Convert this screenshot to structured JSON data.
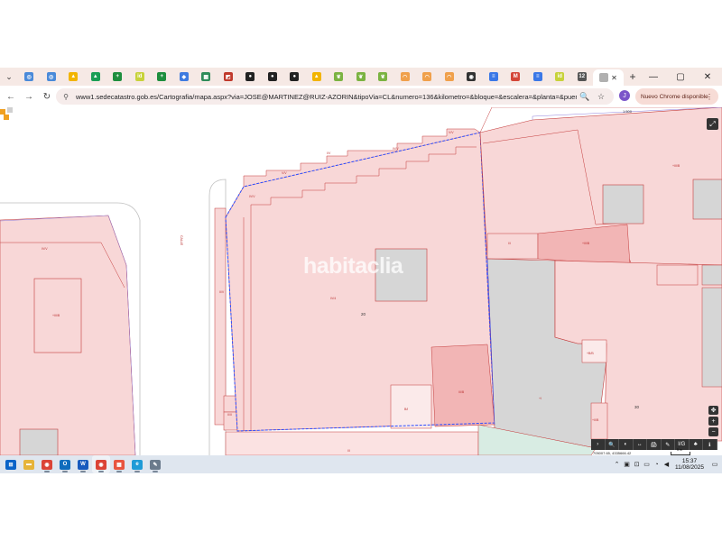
{
  "browser": {
    "tabs": [
      {
        "icon": "tab-favicon-1",
        "color": "#4a8ad9",
        "glyph": "◎"
      },
      {
        "icon": "tab-favicon-2",
        "color": "#4a8ad9",
        "glyph": "◎"
      },
      {
        "icon": "google-drive-icon",
        "color": "#f2b400",
        "glyph": "▲"
      },
      {
        "icon": "google-drive-icon",
        "color": "#1a9e55",
        "glyph": "▲"
      },
      {
        "icon": "google-sheets-icon",
        "color": "#1e8e3e",
        "glyph": "+"
      },
      {
        "icon": "idealista-icon",
        "color": "#c7d23a",
        "glyph": "id"
      },
      {
        "icon": "google-sheets-icon",
        "color": "#1e8e3e",
        "glyph": "+"
      },
      {
        "icon": "maps-icon",
        "color": "#3f7be0",
        "glyph": "◆"
      },
      {
        "icon": "sheets-grid-icon",
        "color": "#2f8c5a",
        "glyph": "▦"
      },
      {
        "icon": "red-doc-icon",
        "color": "#c0392b",
        "glyph": "◩"
      },
      {
        "icon": "black-circle-icon",
        "color": "#222222",
        "glyph": "●"
      },
      {
        "icon": "black-circle-icon",
        "color": "#222222",
        "glyph": "●"
      },
      {
        "icon": "black-circle-icon",
        "color": "#222222",
        "glyph": "●"
      },
      {
        "icon": "google-drive-icon",
        "color": "#f2b400",
        "glyph": "▲"
      },
      {
        "icon": "green-leaf-icon",
        "color": "#7bb342",
        "glyph": "❦"
      },
      {
        "icon": "green-leaf-icon",
        "color": "#7bb342",
        "glyph": "❦"
      },
      {
        "icon": "green-leaf-icon",
        "color": "#7bb342",
        "glyph": "❦"
      },
      {
        "icon": "orange-arc-icon",
        "color": "#f0a04b",
        "glyph": "◠"
      },
      {
        "icon": "orange-arc-icon",
        "color": "#f0a04b",
        "glyph": "◠"
      },
      {
        "icon": "orange-arc-icon",
        "color": "#f0a04b",
        "glyph": "◠"
      },
      {
        "icon": "black-circle-icon",
        "color": "#333333",
        "glyph": "◉"
      },
      {
        "icon": "google-docs-icon",
        "color": "#3b78e7",
        "glyph": "≡"
      },
      {
        "icon": "gmail-icon",
        "color": "#d44638",
        "glyph": "M"
      },
      {
        "icon": "google-docs-icon",
        "color": "#3b78e7",
        "glyph": "≡"
      },
      {
        "icon": "idealista-icon",
        "color": "#c7d23a",
        "glyph": "id"
      },
      {
        "icon": "number-12-icon",
        "color": "#555555",
        "glyph": "12"
      }
    ],
    "active_tab": {
      "icon": "catastro-favicon-icon",
      "color": "#b0b0b0"
    },
    "url": "www1.sedecatastro.gob.es/Cartografia/mapa.aspx?via=JOSE@MARTINEZ@RUIZ-AZORIN&tipoVia=CL&numero=136&kilometro=&bloque=&escalera=&planta=&puerta=...",
    "profile_initial": "J",
    "update_label": "Nuevo Chrome disponible"
  },
  "map": {
    "watermark": "habitaclia",
    "street_label": "CALLE",
    "parcel_number_main": "20",
    "parcel_number_right": "30",
    "fullscreen_glyph": "⤢",
    "scale_text": "1:500",
    "coord_text": "705007.65, 4335666.42",
    "zoom_in": "+",
    "zoom_out": "−",
    "scalebar_label": "5 m",
    "toolbar_buttons": [
      "›",
      "🔍",
      "◐",
      "↔",
      "🖨",
      "✎",
      "I/G",
      "♣",
      "ℹ"
    ],
    "labels": {
      "main_building": "IV/4",
      "main_top": "V/V",
      "main_top2": "V/V",
      "main_step": "I/V",
      "main_step2": "IV/V",
      "main_upper_left": "IV/V",
      "main_left_strip": "II/V",
      "main_left_strip2": "II/II",
      "main_lower_right": "III/B",
      "main_lower_mid": "B/I",
      "left_block": "IV/V",
      "left_inner": "+III/B",
      "right_top": "+III/B",
      "right_mid": "+III/B",
      "right_left": "I/I",
      "right_low": "+B/B",
      "right_lower": "+I",
      "right_lower_b": "+II/B",
      "bottom_strip": "I/I"
    }
  },
  "taskbar": {
    "apps": [
      {
        "icon": "windows-start-icon",
        "color": "#0a64c8",
        "glyph": "⊞"
      },
      {
        "icon": "file-explorer-icon",
        "color": "#e6b43a",
        "glyph": "▬"
      },
      {
        "icon": "chrome-icon",
        "color": "#db4437",
        "glyph": "◉"
      },
      {
        "icon": "outlook-icon",
        "color": "#0f6cbd",
        "glyph": "O"
      },
      {
        "icon": "word-icon",
        "color": "#185abd",
        "glyph": "W"
      },
      {
        "icon": "chrome-icon",
        "color": "#db4437",
        "glyph": "◉"
      },
      {
        "icon": "colorful-app-icon",
        "color": "#e8543f",
        "glyph": "▦"
      },
      {
        "icon": "edge-icon",
        "color": "#1f9bd7",
        "glyph": "e"
      },
      {
        "icon": "photos-icon",
        "color": "#6b7b8c",
        "glyph": "✎"
      }
    ],
    "time": "15:37",
    "date": "11/08/2025"
  }
}
